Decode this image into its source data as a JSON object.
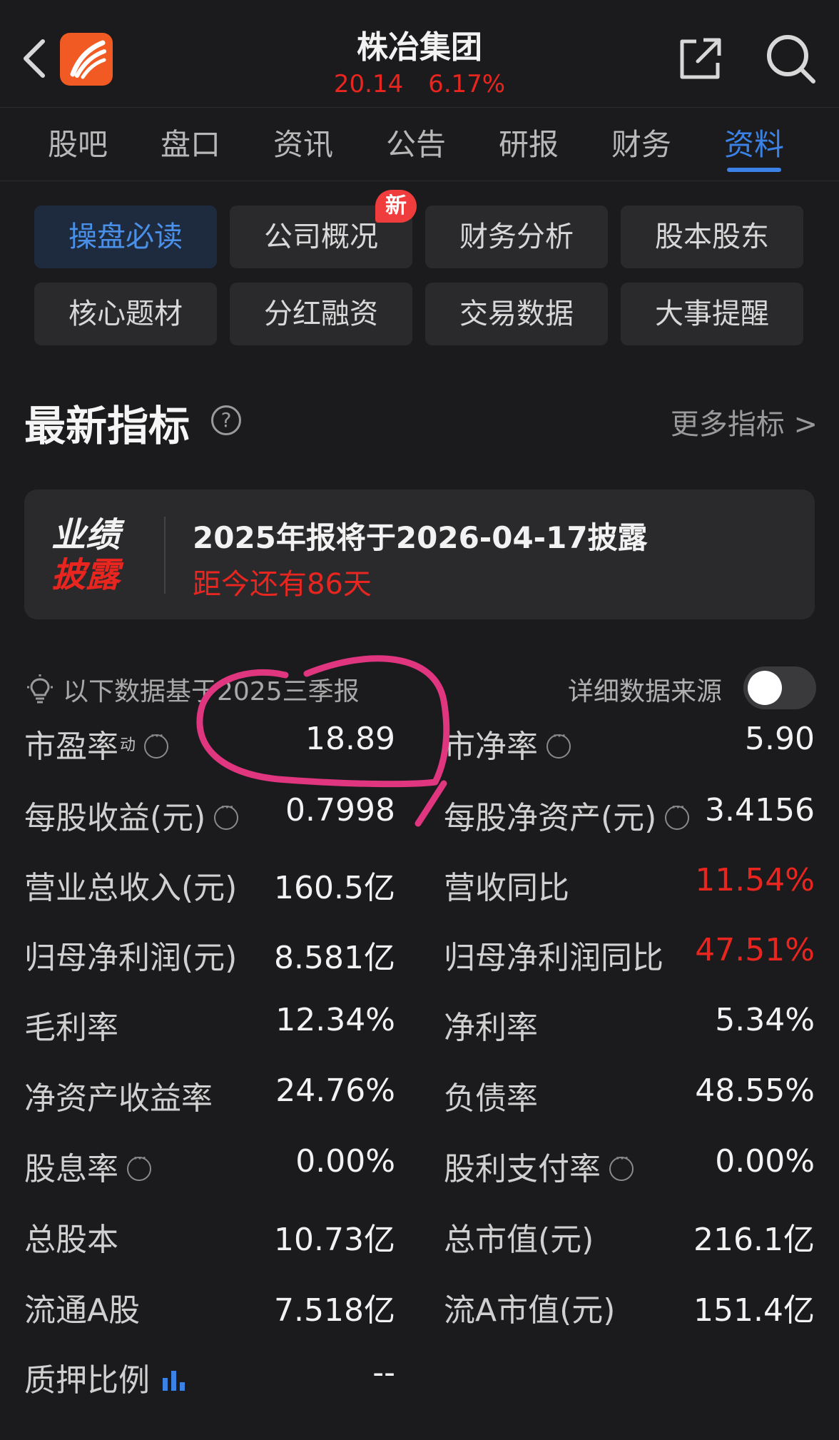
{
  "header": {
    "title": "株冶集团",
    "price": "20.14",
    "change_pct": "6.17%",
    "quote_color": "#e8251f"
  },
  "tabs": [
    "股吧",
    "盘口",
    "资讯",
    "公告",
    "研报",
    "财务",
    "资料"
  ],
  "active_tab": "资料",
  "chips": [
    {
      "label": "操盘必读",
      "active": true
    },
    {
      "label": "公司概况",
      "badge": "新"
    },
    {
      "label": "财务分析"
    },
    {
      "label": "股本股东"
    },
    {
      "label": "核心题材"
    },
    {
      "label": "分红融资"
    },
    {
      "label": "交易数据"
    },
    {
      "label": "大事提醒"
    }
  ],
  "section": {
    "title": "最新指标",
    "help_icon": "?",
    "more_link": "更多指标 >"
  },
  "disclosure_card": {
    "logo_line1": "业绩",
    "logo_line2": "披露",
    "main": "2025年报将于2026-04-17披露",
    "sub": "距今还有86天"
  },
  "basis": {
    "text": "以下数据基于2025三季报",
    "source_label": "详细数据来源",
    "toggle_on": false
  },
  "metrics": {
    "pe": {
      "label": "市盈率",
      "sup": "动",
      "value": "18.89"
    },
    "pb": {
      "label": "市净率",
      "value": "5.90"
    },
    "eps": {
      "label": "每股收益(元)",
      "value": "0.7998"
    },
    "bps": {
      "label": "每股净资产(元)",
      "value": "3.4156"
    },
    "revenue": {
      "label": "营业总收入(元)",
      "value": "160.5亿"
    },
    "revenue_yoy": {
      "label": "营收同比",
      "value": "11.54%"
    },
    "net_profit": {
      "label": "归母净利润(元)",
      "value": "8.581亿"
    },
    "net_profit_yoy": {
      "label": "归母净利润同比",
      "value": "47.51%"
    },
    "gross_margin": {
      "label": "毛利率",
      "value": "12.34%"
    },
    "net_margin": {
      "label": "净利率",
      "value": "5.34%"
    },
    "roe": {
      "label": "净资产收益率",
      "value": "24.76%"
    },
    "debt_ratio": {
      "label": "负债率",
      "value": "48.55%"
    },
    "dividend_yield": {
      "label": "股息率",
      "value": "0.00%"
    },
    "payout_ratio": {
      "label": "股利支付率",
      "value": "0.00%"
    },
    "total_shares": {
      "label": "总股本",
      "value": "10.73亿"
    },
    "market_cap": {
      "label": "总市值(元)",
      "value": "216.1亿"
    },
    "float_a": {
      "label": "流通A股",
      "value": "7.518亿"
    },
    "float_a_cap": {
      "label": "流A市值(元)",
      "value": "151.4亿"
    },
    "pledge_ratio": {
      "label": "质押比例",
      "value": "--"
    }
  },
  "colors": {
    "accent_blue": "#3b82e6",
    "up_red": "#e8251f",
    "annotation_pink": "#e0357f",
    "background": "#1b1b1d"
  }
}
